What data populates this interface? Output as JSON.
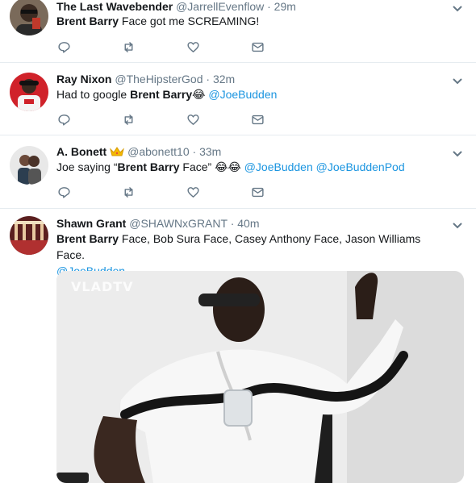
{
  "tweets": [
    {
      "name": "The Last Wavebender",
      "handle": "@JarrellEvenflow",
      "dot": "·",
      "time": "29m",
      "text_bold": "Brent Barry",
      "text_rest": " Face got me SCREAMING!"
    },
    {
      "name": "Ray Nixon",
      "handle": "@TheHipsterGod",
      "dot": "·",
      "time": "32m",
      "text_pre": "Had to google ",
      "text_bold": "Brent Barry",
      "emoji": "😂",
      "mention": "@JoeBudden"
    },
    {
      "name": "A. Bonett",
      "handle": "@abonett10",
      "dot": "·",
      "time": "33m",
      "text_pre": "Joe saying “",
      "text_bold": "Brent Barry",
      "text_mid": " Face” ",
      "emoji": "😂😂",
      "mention1": "@JoeBudden",
      "mention2": "@JoeBuddenPod"
    },
    {
      "name": "Shawn Grant",
      "handle": "@SHAWNxGRANT",
      "dot": "·",
      "time": "40m",
      "text_bold": "Brent Barry",
      "text_rest": " Face, Bob Sura Face, Casey Anthony Face, Jason Williams Face.",
      "mention": "@JoeBudden",
      "media_watermark": "VLADTV"
    }
  ],
  "icons": {
    "reply": "reply-icon",
    "retweet": "retweet-icon",
    "like": "like-icon",
    "dm": "direct-message-icon",
    "caret": "chevron-down-icon",
    "crown": "crown-emoji-icon"
  },
  "colors": {
    "link": "#1b95e0",
    "secondary": "#657786",
    "divider": "#e6ecf0"
  }
}
